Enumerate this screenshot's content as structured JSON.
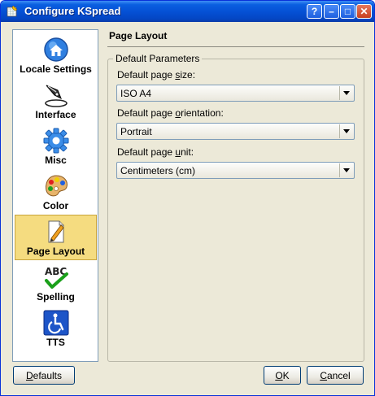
{
  "window": {
    "title": "Configure KSpread"
  },
  "titlebar": {
    "help": "?",
    "minimize": "–",
    "maximize": "□",
    "close": "✕"
  },
  "sidebar": {
    "items": [
      {
        "label": "Locale Settings",
        "icon": "home-globe-icon",
        "selected": false
      },
      {
        "label": "Interface",
        "icon": "pen-nib-icon",
        "selected": false
      },
      {
        "label": "Misc",
        "icon": "gear-icon",
        "selected": false
      },
      {
        "label": "Color",
        "icon": "palette-icon",
        "selected": false
      },
      {
        "label": "Page Layout",
        "icon": "page-pencil-icon",
        "selected": true
      },
      {
        "label": "Spelling",
        "icon": "abc-check-icon",
        "selected": false
      },
      {
        "label": "TTS",
        "icon": "accessibility-icon",
        "selected": false
      }
    ]
  },
  "main": {
    "title": "Page Layout",
    "group_title": "Default Parameters",
    "page_size": {
      "label_pre": "Default page ",
      "label_u": "s",
      "label_post": "ize:",
      "value": "ISO A4"
    },
    "orientation": {
      "label_pre": "Default page ",
      "label_u": "o",
      "label_post": "rientation:",
      "value": "Portrait"
    },
    "unit": {
      "label_pre": "Default page ",
      "label_u": "u",
      "label_post": "nit:",
      "value": "Centimeters (cm)"
    }
  },
  "buttons": {
    "defaults": {
      "u": "D",
      "rest": "efaults"
    },
    "ok": {
      "u": "O",
      "rest": "K"
    },
    "cancel": {
      "u": "C",
      "rest": "ancel"
    }
  },
  "colors": {
    "titlebar": "#0551d6",
    "selection": "#f5dc80",
    "dialog": "#ece9d8"
  }
}
